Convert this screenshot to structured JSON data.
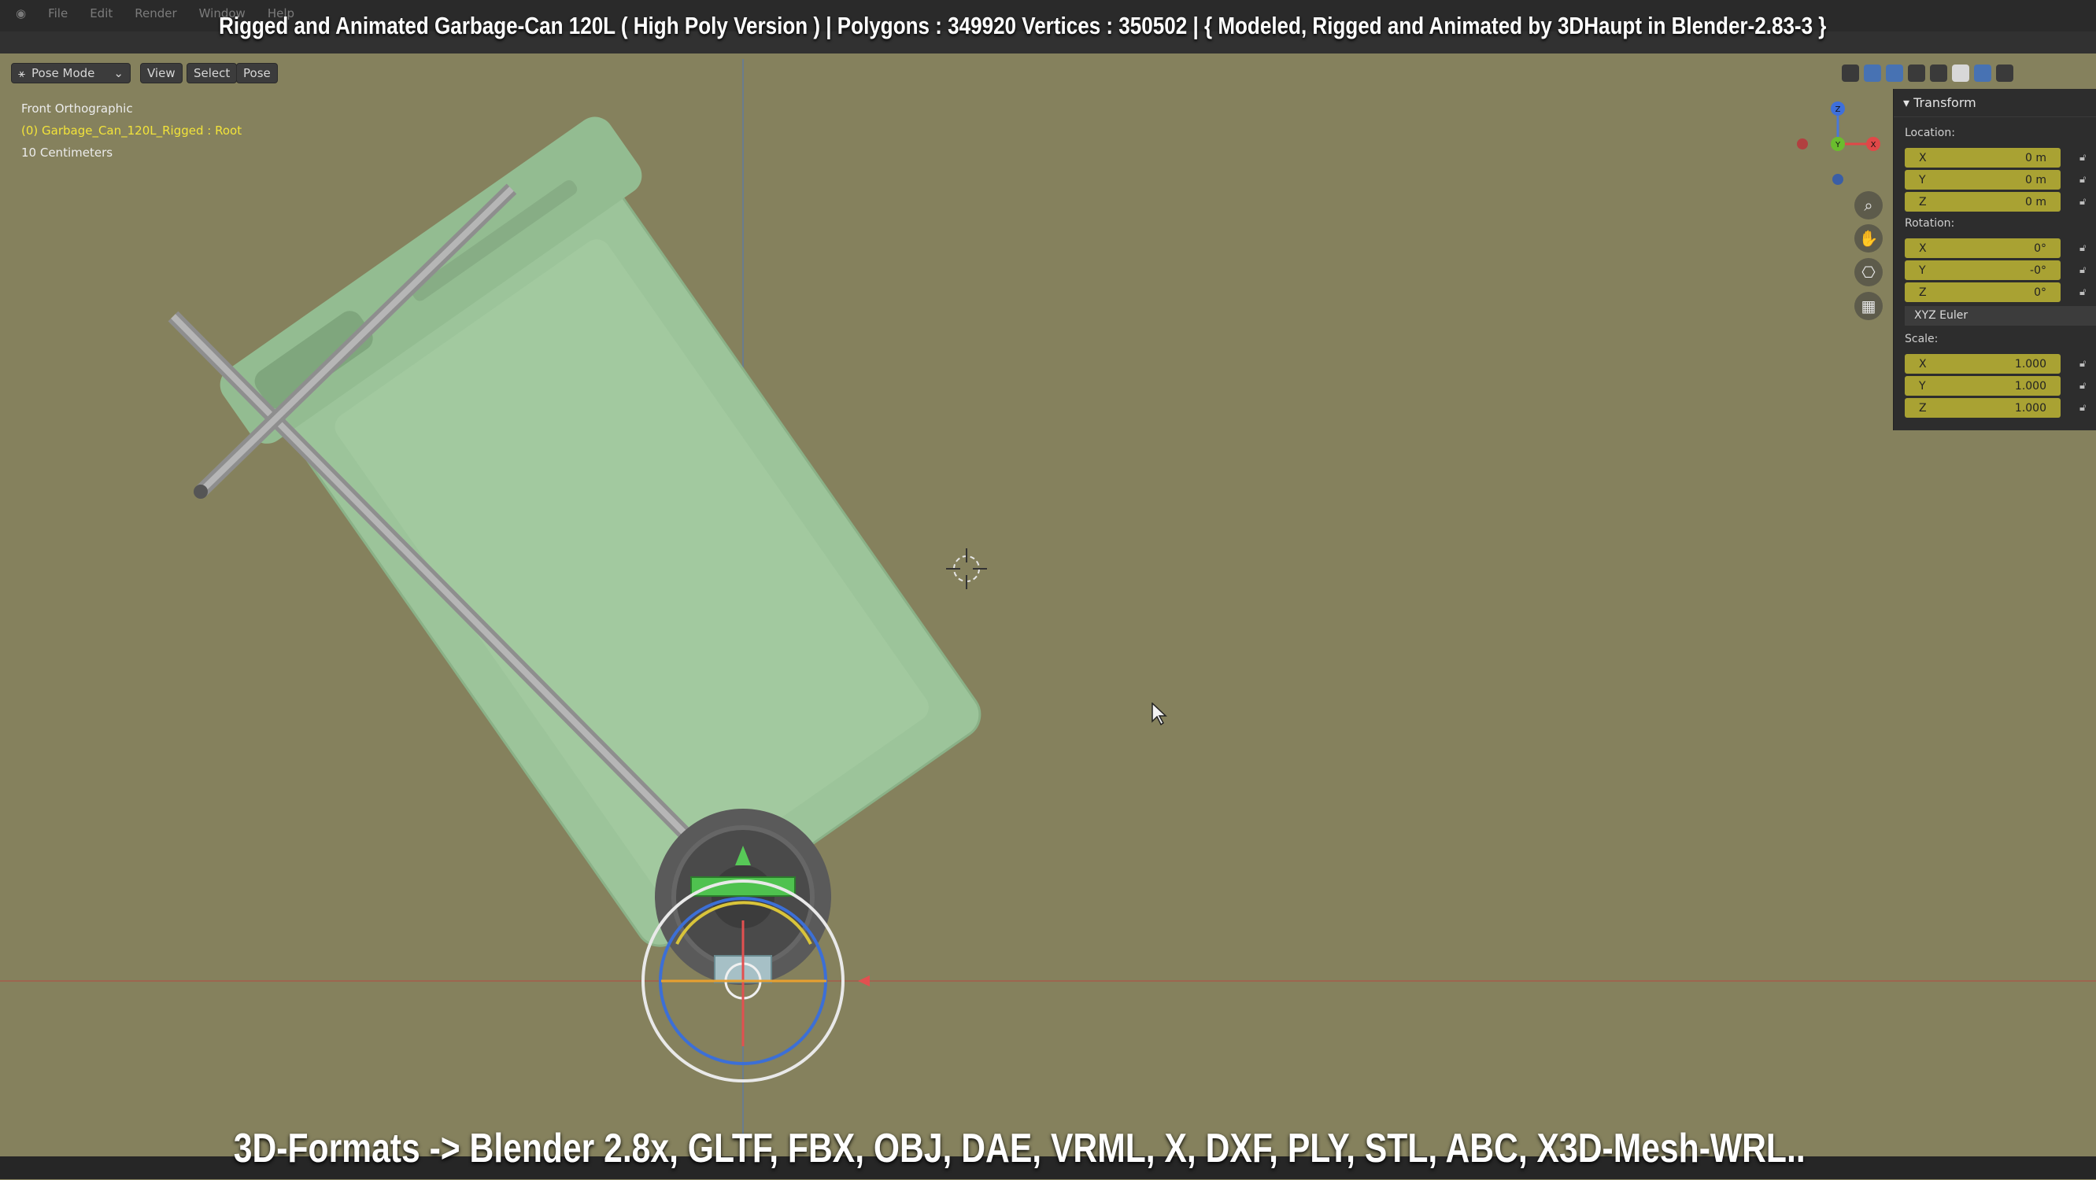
{
  "top_menu": [
    "File",
    "Edit",
    "Render",
    "Window",
    "Help"
  ],
  "title_overlay": "Rigged and Animated Garbage-Can 120L ( High Poly Version ) |  Polygons : 349920  Vertices : 350502   |   { Modeled, Rigged and Animated by 3DHaupt in Blender-2.83-3 }",
  "header": {
    "mode": "Pose Mode",
    "view": "View",
    "select": "Select",
    "pose": "Pose"
  },
  "viewport_info": {
    "projection": "Front Orthographic",
    "object": "(0) Garbage_Can_120L_Rigged : Root",
    "scale": "10 Centimeters"
  },
  "navigation_gizmo": {
    "z": "Z",
    "y": "Y",
    "x": "X"
  },
  "transform_panel": {
    "title": "Transform",
    "location_label": "Location:",
    "location": [
      {
        "axis": "X",
        "value": "0 m"
      },
      {
        "axis": "Y",
        "value": "0 m"
      },
      {
        "axis": "Z",
        "value": "0 m"
      }
    ],
    "rotation_label": "Rotation:",
    "rotation": [
      {
        "axis": "X",
        "value": "0°"
      },
      {
        "axis": "Y",
        "value": "-0°"
      },
      {
        "axis": "Z",
        "value": "0°"
      }
    ],
    "rotation_mode": "XYZ Euler",
    "scale_label": "Scale:",
    "scale": [
      {
        "axis": "X",
        "value": "1.000"
      },
      {
        "axis": "Y",
        "value": "1.000"
      },
      {
        "axis": "Z",
        "value": "1.000"
      }
    ]
  },
  "bottom_caption": "3D-Formats -> Blender 2.8x, GLTF, FBX, OBJ, DAE, VRML, X, DXF, PLY, STL, ABC, X3D-Mesh-WRL..",
  "colors": {
    "viewport_bg": "#85815d",
    "bin_green": "#9cc49a",
    "field_yellow": "#a9a233",
    "object_text": "#f2e33a"
  }
}
